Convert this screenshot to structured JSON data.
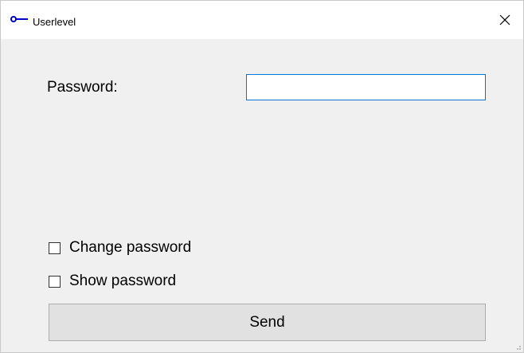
{
  "window": {
    "title": "Userlevel",
    "icon": "key-icon",
    "close_icon": "close-icon",
    "accent": "#0078d7"
  },
  "form": {
    "password_label": "Password:",
    "password_value": "",
    "password_placeholder": "",
    "change_password_label": "Change password",
    "change_password_checked": false,
    "show_password_label": "Show password",
    "show_password_checked": false,
    "send_label": "Send"
  }
}
